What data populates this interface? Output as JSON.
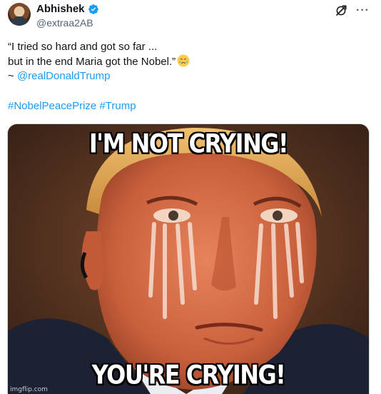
{
  "author": {
    "name": "Abhishek",
    "handle": "@extraa2AB",
    "verified": true
  },
  "tweet": {
    "line1": "“I tried so hard and got so far ...",
    "line2": "but in the end Maria got the Nobel.”",
    "line2_emoji": "face-holding-back-tears",
    "line3_prefix": "~ ",
    "mention": "@realDonaldTrump",
    "hashtags": [
      "#NobelPeacePrize",
      "#Trump"
    ]
  },
  "media": {
    "caption_top": "I'M NOT CRYING!",
    "caption_bottom": "YOU'RE CRYING!",
    "watermark": "imgflip.com"
  },
  "colors": {
    "link": "#1d9bf0",
    "verified": "#1d9bf0",
    "secondary_text": "#536471"
  },
  "icons": {
    "verified": "verified-badge-icon",
    "grok": "grok-icon",
    "more": "more-options-icon"
  }
}
